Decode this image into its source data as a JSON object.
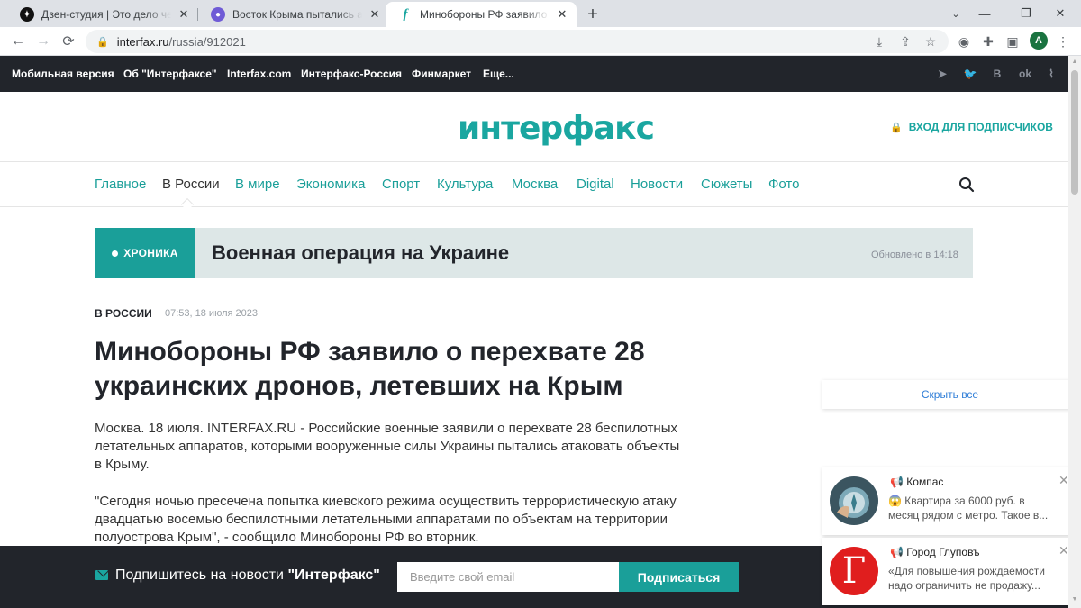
{
  "browser": {
    "tabs": [
      {
        "title": "Дзен-студия | Это дело чести – ",
        "active": false
      },
      {
        "title": "Восток Крыма пытались атаковать",
        "active": false
      },
      {
        "title": "Минобороны РФ заявило о перехвате",
        "active": true
      }
    ],
    "url_host": "interfax.ru",
    "url_path": "/russia/912021",
    "profile_initial": "A"
  },
  "topnav": {
    "links": [
      "Мобильная версия",
      "Об \"Интерфаксе\"",
      "Interfax.com",
      "Интерфакс-Россия",
      "Финмаркет",
      "Еще..."
    ],
    "social": [
      "telegram-icon",
      "twitter-icon",
      "vk-icon",
      "ok-icon",
      "rss-icon"
    ]
  },
  "header": {
    "logo": "интерфакс",
    "login": "ВХОД ДЛЯ ПОДПИСЧИКОВ"
  },
  "mainnav": {
    "items": [
      "Главное",
      "В России",
      "В мире",
      "Экономика",
      "Спорт",
      "Культура",
      "Москва",
      "Digital",
      "Новости",
      "Сюжеты",
      "Фото"
    ],
    "current": "В России"
  },
  "chronicle": {
    "badge": "ХРОНИКА",
    "title": "Военная операция на Украине",
    "updated": "Обновлено в 14:18"
  },
  "article": {
    "rubric": "В РОССИИ",
    "date": "07:53, 18 июля 2023",
    "headline": "Минобороны РФ заявило о перехвате 28 украинских дронов, летевших на Крым",
    "paragraphs": [
      "Москва. 18 июля. INTERFAX.RU - Российские военные заявили о перехвате 28 беспилотных летательных аппаратов, которыми вооруженные силы Украины пытались атаковать объекты в Крыму.",
      "\"Сегодня ночью пресечена попытка киевского режима осуществить террористическую атаку двадцатью восемью беспилотными летательными аппаратами по объектам на территории полуострова Крым\", - сообщило Минобороны РФ во вторник."
    ]
  },
  "subscribe": {
    "text": "Подпишитесь на новости ",
    "brand": "\"Интерфакс\"",
    "placeholder": "Введите свой email",
    "button": "Подписаться"
  },
  "notifications": {
    "hide_all": "Скрыть все",
    "items": [
      {
        "source": "Компас",
        "body": "😱 Квартира за 6000 руб. в месяц рядом с метро.  Такое в..."
      },
      {
        "source": "Город Глуповъ",
        "body": "«Для повышения рождаемости надо ограничить не продажу..."
      }
    ],
    "second_avatar_letter": "Г"
  }
}
